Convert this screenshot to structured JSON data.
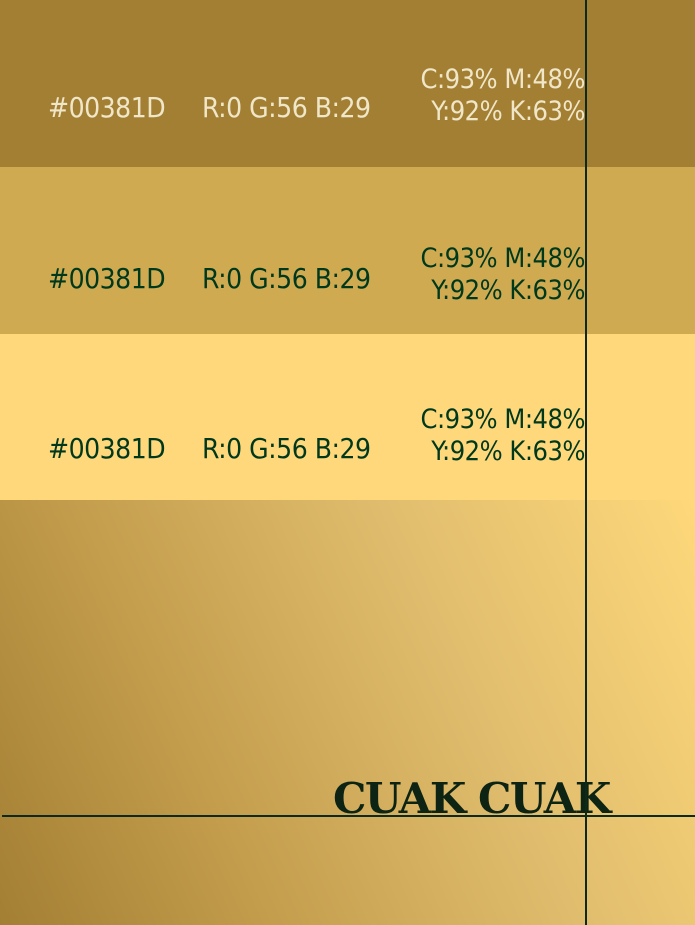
{
  "colors": {
    "dark_green": "#00381D",
    "band_dark_gold": "#a37f34",
    "band_mid_gold": "#cfaa50",
    "band_light_gold": "#fed87a",
    "light_text": "#f0e6c8"
  },
  "swatches": [
    {
      "hex": "#00381D",
      "rgb": "R:0 G:56 B:29",
      "cmyk_line1": "C:93% M:48%",
      "cmyk_line2": "Y:92% K:63%"
    },
    {
      "hex": "#00381D",
      "rgb": "R:0 G:56 B:29",
      "cmyk_line1": "C:93% M:48%",
      "cmyk_line2": "Y:92% K:63%"
    },
    {
      "hex": "#00381D",
      "rgb": "R:0 G:56 B:29",
      "cmyk_line1": "C:93% M:48%",
      "cmyk_line2": "Y:92% K:63%"
    }
  ],
  "brand": {
    "title": "CUAK CUAK"
  }
}
